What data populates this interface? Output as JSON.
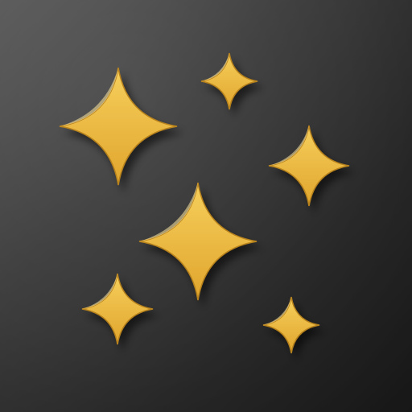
{
  "icon": {
    "name": "sparkles-icon",
    "sparkle_count": 6
  },
  "colors": {
    "background_light": "#5a5a5a",
    "background_dark": "#1e1e1e",
    "sparkle_fill_top": "#f6cf5c",
    "sparkle_fill_bottom": "#e0a52c",
    "sparkle_edge": "#b8821c",
    "sparkle_highlight": "#ffe9a3"
  }
}
